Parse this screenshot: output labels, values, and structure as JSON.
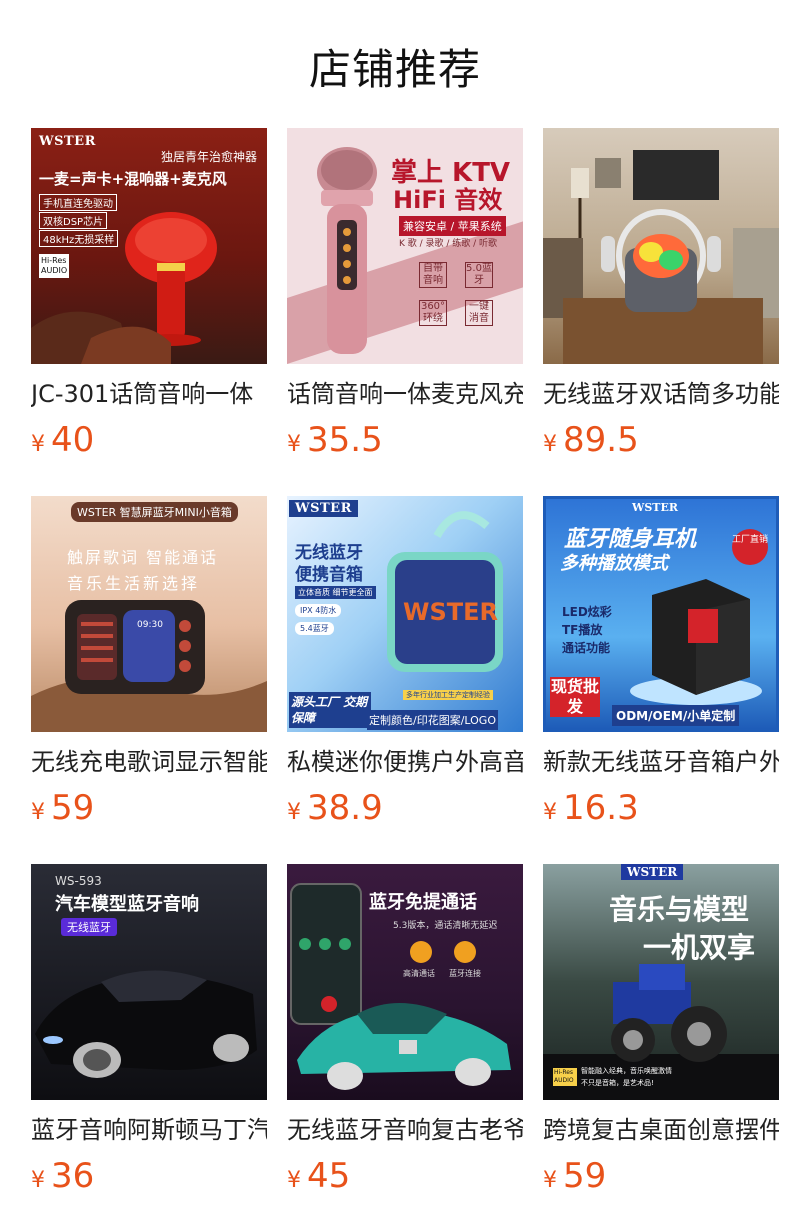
{
  "header": {
    "title": "店铺推荐"
  },
  "products": [
    {
      "name": "JC-301话筒音响一体",
      "currency": "¥",
      "price": "40",
      "thumb": {
        "bg": "#7a1a12",
        "accent": "#e0241b",
        "brand": "WSTER",
        "sub": "独居青年治愈神器",
        "headline": "一麦=声卡+混响器+麦克风",
        "tags": [
          "手机直连免驱动",
          "双核DSP芯片",
          "48kHz无损采样"
        ],
        "badge": "Hi-Res AUDIO"
      }
    },
    {
      "name": "话筒音响一体麦克风充",
      "currency": "¥",
      "price": "35.5",
      "thumb": {
        "bg": "#f2dfe2",
        "accent": "#b7162b",
        "headline": "掌上 KTV",
        "headline2": "HiFi 音效",
        "sub": "兼容安卓 / 苹果系统",
        "sub2": "K 歌 / 录歌 / 练歌 / 听歌",
        "tags": [
          "自带音响",
          "5.0蓝牙",
          "360°环绕",
          "一键消音"
        ]
      }
    },
    {
      "name": "无线蓝牙双话筒多功能",
      "currency": "¥",
      "price": "89.5",
      "thumb": {
        "bg": "#c9b49a",
        "accent": "#7b5a3a"
      }
    },
    {
      "name": "无线充电歌词显示智能",
      "currency": "¥",
      "price": "59",
      "thumb": {
        "bg": "#f0d7c3",
        "accent": "#3a2a26",
        "brand": "WSTER",
        "sub": "智慧屏蓝牙MINI小音箱",
        "headline": "触屏歌词  智能通话",
        "headline2": "音乐生活新选择",
        "screen": "09:30"
      }
    },
    {
      "name": "私模迷你便携户外高音",
      "currency": "¥",
      "price": "38.9",
      "thumb": {
        "bg": "#3f8ed8",
        "accent": "#1e3f8f",
        "brand": "WSTER",
        "headline": "无线蓝牙",
        "headline2": "便携音箱",
        "tags": [
          "立体音质 细节更全面",
          "IPX 4防水",
          "5.4蓝牙"
        ],
        "footer": "源头工厂 交期保障",
        "footer2": "定制颜色/印花图案/LOGO",
        "logo": "WSTER",
        "note": "多年行业加工生产定制经验"
      }
    },
    {
      "name": "新款无线蓝牙音箱户外",
      "currency": "¥",
      "price": "16.3",
      "thumb": {
        "bg": "#2e74d6",
        "accent": "#d4232a",
        "brand": "WSTER",
        "headline": "蓝牙随身耳机",
        "headline2": "多种播放模式",
        "tags": [
          "LED炫彩",
          "TF播放",
          "通话功能"
        ],
        "corner": "工厂直销",
        "footer": "现货批发",
        "footer2": "ODM/OEM/小单定制"
      }
    },
    {
      "name": "蓝牙音响阿斯顿马丁汽",
      "currency": "¥",
      "price": "36",
      "thumb": {
        "bg": "#1a1b22",
        "accent": "#5a2bd8",
        "sub": "WS-593",
        "headline": "汽车模型蓝牙音响",
        "tags": [
          "无线蓝牙"
        ]
      }
    },
    {
      "name": "无线蓝牙音响复古老爷",
      "currency": "¥",
      "price": "45",
      "thumb": {
        "bg": "#2a1430",
        "accent": "#27b3a5",
        "headline": "蓝牙免提通话",
        "sub": "5.3版本，通话清晰无延迟",
        "tags": [
          "高清通话",
          "蓝牙连接"
        ]
      }
    },
    {
      "name": "跨境复古桌面创意摆件",
      "currency": "¥",
      "price": "59",
      "thumb": {
        "bg": "#31403a",
        "accent": "#1f3aa0",
        "brand": "WSTER",
        "headline": "音乐与模型",
        "headline2": "一机双享",
        "sub": "智能融入经典，音乐唤醒激情",
        "sub2": "不只是音箱，是艺术品!",
        "badge": "Hi-Res AUDIO"
      }
    }
  ]
}
